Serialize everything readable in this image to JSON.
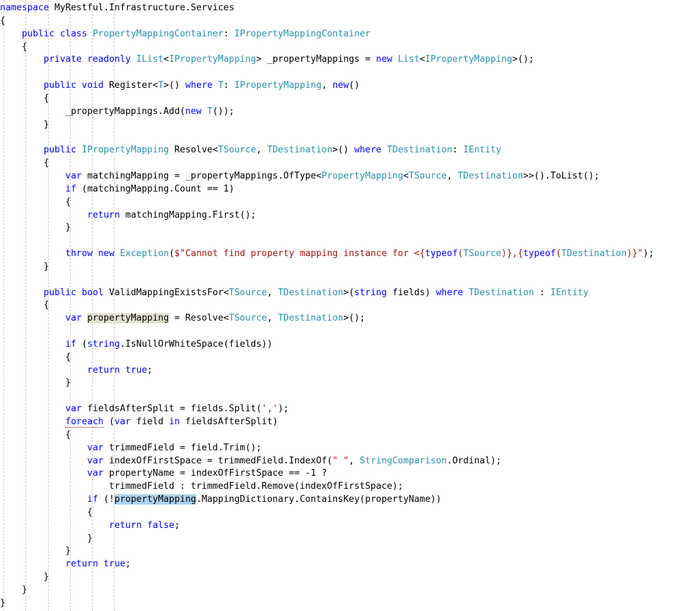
{
  "editor": {
    "language": "csharp",
    "background": "#ffffff",
    "colors": {
      "keyword": "#0000ff",
      "type": "#2b91af",
      "string": "#a31515",
      "plain": "#000000",
      "indent_guide": "#c8c8c8",
      "highlight_reference": "#e4e2cf",
      "highlight_selection": "#aed3ee",
      "error_squiggle": "#d40000"
    },
    "indent_guides_x": [
      5,
      37,
      70,
      102,
      134,
      166
    ],
    "highlighted_symbol": "propertyMapping",
    "selected_symbol": "propertyMapping"
  },
  "code": {
    "lines": [
      "namespace MyRestful.Infrastructure.Services",
      "{",
      "    public class PropertyMappingContainer: IPropertyMappingContainer",
      "    {",
      "        private readonly IList<IPropertyMapping> _propertyMappings = new List<IPropertyMapping>();",
      "",
      "        public void Register<T>() where T: IPropertyMapping, new()",
      "        {",
      "            _propertyMappings.Add(new T());",
      "        }",
      "",
      "        public IPropertyMapping Resolve<TSource, TDestination>() where TDestination: IEntity",
      "        {",
      "            var matchingMapping = _propertyMappings.OfType<PropertyMapping<TSource, TDestination>>().ToList();",
      "            if (matchingMapping.Count == 1)",
      "            {",
      "                return matchingMapping.First();",
      "            }",
      "",
      "            throw new Exception($\"Cannot find property mapping instance for <{typeof(TSource)},{typeof(TDestination)}\");",
      "        }",
      "",
      "        public bool ValidMappingExistsFor<TSource, TDestination>(string fields) where TDestination : IEntity",
      "        {",
      "            var propertyMapping = Resolve<TSource, TDestination>();",
      "",
      "            if (string.IsNullOrWhiteSpace(fields))",
      "            {",
      "                return true;",
      "            }",
      "",
      "            var fieldsAfterSplit = fields.Split(',');",
      "            foreach (var field in fieldsAfterSplit)",
      "            {",
      "                var trimmedField = field.Trim();",
      "                var indexOfFirstSpace = trimmedField.IndexOf(\" \", StringComparison.Ordinal);",
      "                var propertyName = indexOfFirstSpace == -1 ?",
      "                    trimmedField : trimmedField.Remove(indexOfFirstSpace);",
      "                if (!propertyMapping.MappingDictionary.ContainsKey(propertyName))",
      "                {",
      "                    return false;",
      "                }",
      "            }",
      "            return true;",
      "        }",
      "    }",
      "}"
    ],
    "namespace": "MyRestful.Infrastructure.Services",
    "class_name": "PropertyMappingContainer",
    "base_interface": "IPropertyMappingContainer",
    "field": "_propertyMappings",
    "methods": [
      "Register<T>",
      "Resolve<TSource, TDestination>",
      "ValidMappingExistsFor<TSource, TDestination>"
    ],
    "exception_message": "Cannot find property mapping instance for <{typeof(TSource)},{typeof(TDestination)}"
  }
}
